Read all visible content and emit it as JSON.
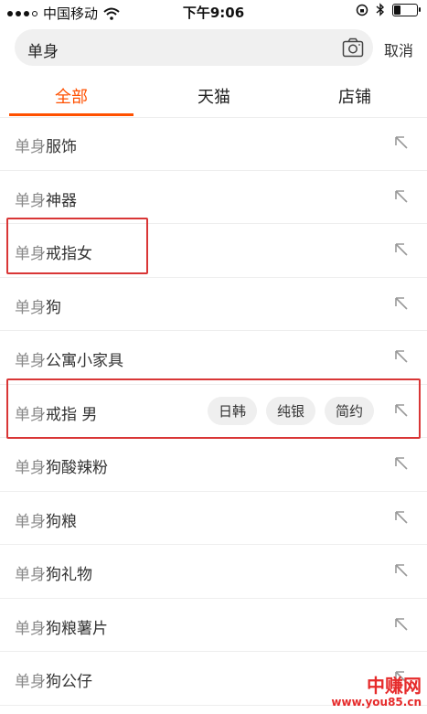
{
  "status_bar": {
    "carrier": "中国移动",
    "time": "下午9:06",
    "battery_level": 0.25
  },
  "search": {
    "query": "单身",
    "cancel_label": "取消"
  },
  "tabs": [
    {
      "label": "全部",
      "active": true
    },
    {
      "label": "天猫",
      "active": false
    },
    {
      "label": "店铺",
      "active": false
    }
  ],
  "suggestions": [
    {
      "prefix": "单身",
      "rest": "服饰"
    },
    {
      "prefix": "单身",
      "rest": "神器"
    },
    {
      "prefix": "单身",
      "rest": "戒指女"
    },
    {
      "prefix": "单身",
      "rest": "狗"
    },
    {
      "prefix": "单身",
      "rest": "公寓小家具"
    },
    {
      "prefix": "单身",
      "rest": "戒指 男",
      "chips": [
        "日韩",
        "纯银",
        "简约"
      ]
    },
    {
      "prefix": "单身",
      "rest": "狗酸辣粉"
    },
    {
      "prefix": "单身",
      "rest": "狗粮"
    },
    {
      "prefix": "单身",
      "rest": "狗礼物"
    },
    {
      "prefix": "单身",
      "rest": "狗粮薯片"
    },
    {
      "prefix": "单身",
      "rest": "狗公仔"
    }
  ],
  "watermark": {
    "title": "中赚网",
    "url": "www.you85.cn"
  },
  "colors": {
    "accent": "#ff5000",
    "highlight": "#d93636"
  }
}
